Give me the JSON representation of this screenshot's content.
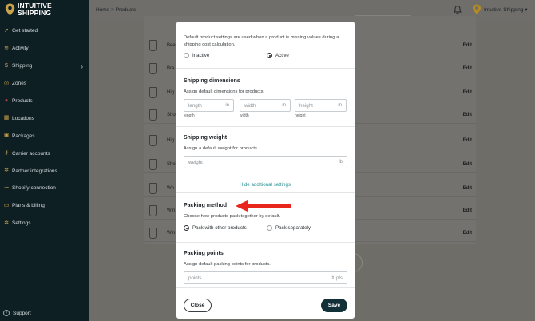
{
  "brand": {
    "line1": "INTUITIVE",
    "line2": "SHIPPING"
  },
  "sidebar": {
    "items": [
      {
        "label": "Get started",
        "icon": "rocket-icon"
      },
      {
        "label": "Activity",
        "icon": "activity-icon"
      },
      {
        "label": "Shipping",
        "icon": "dollar-icon"
      },
      {
        "label": "Zones",
        "icon": "zones-icon"
      },
      {
        "label": "Products",
        "icon": "shirt-icon"
      },
      {
        "label": "Locations",
        "icon": "building-icon"
      },
      {
        "label": "Packages",
        "icon": "box-icon"
      },
      {
        "label": "Carrier accounts",
        "icon": "key-icon"
      },
      {
        "label": "Partner integrations",
        "icon": "gear-icon"
      },
      {
        "label": "Shopify connection",
        "icon": "link-icon"
      },
      {
        "label": "Plans & billing",
        "icon": "card-icon"
      },
      {
        "label": "Settings",
        "icon": "gear-icon"
      }
    ],
    "support": "Support"
  },
  "header": {
    "breadcrumb": "Home > Products",
    "account": "Intuitive Shipping ▾"
  },
  "bg_products": {
    "rows": [
      {
        "name": "Bee"
      },
      {
        "name": "Bra"
      },
      {
        "name": "Hig"
      },
      {
        "name": "Sho"
      },
      {
        "name": "Hig"
      },
      {
        "name": "She"
      },
      {
        "name": "Wh"
      },
      {
        "name": "Win"
      },
      {
        "name": "Win"
      }
    ],
    "edit_label": "Edit"
  },
  "modal": {
    "status": {
      "description": "Default product settings are used when a product is missing values during a shipping cost calculation.",
      "options": [
        "Inactive",
        "Active"
      ],
      "selected": "Active"
    },
    "dimensions": {
      "title": "Shipping dimensions",
      "description": "Assign default dimensions for products.",
      "fields": [
        {
          "placeholder": "length",
          "unit": "in",
          "label": "length"
        },
        {
          "placeholder": "width",
          "unit": "in",
          "label": "width"
        },
        {
          "placeholder": "height",
          "unit": "in",
          "label": "height"
        }
      ]
    },
    "weight": {
      "title": "Shipping weight",
      "description": "Assign a default weight for products.",
      "placeholder": "weight",
      "unit": "lb"
    },
    "toggle_link": "Hide additional settings",
    "packing": {
      "title": "Packing method",
      "description": "Choose how products pack together by default.",
      "options": [
        "Pack with other products",
        "Pack separately"
      ],
      "selected": "Pack with other products"
    },
    "points": {
      "title": "Packing points",
      "description": "Assign default packing points for products.",
      "placeholder": "points",
      "unit": "pts"
    },
    "close_label": "Close",
    "save_label": "Save"
  },
  "colors": {
    "accent": "#2a8f94",
    "primary": "#123038",
    "brand": "#c9a34a",
    "arrow": "#e8261b"
  }
}
